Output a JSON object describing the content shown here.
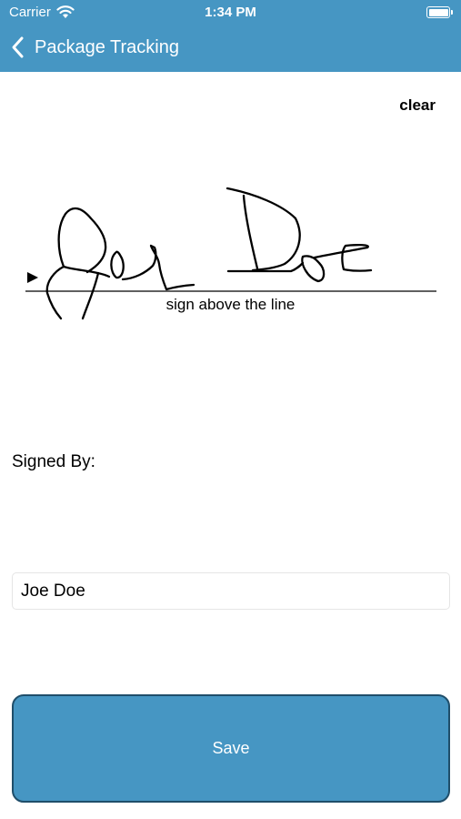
{
  "status_bar": {
    "carrier": "Carrier",
    "time": "1:34 PM"
  },
  "nav": {
    "title": "Package Tracking"
  },
  "signature_pad": {
    "clear_label": "clear",
    "caption": "sign above the line"
  },
  "form": {
    "signed_by_label": "Signed By:",
    "name_value": "Joe Doe",
    "save_label": "Save"
  },
  "colors": {
    "accent": "#4696c3",
    "save_border": "#1f4e6a"
  }
}
